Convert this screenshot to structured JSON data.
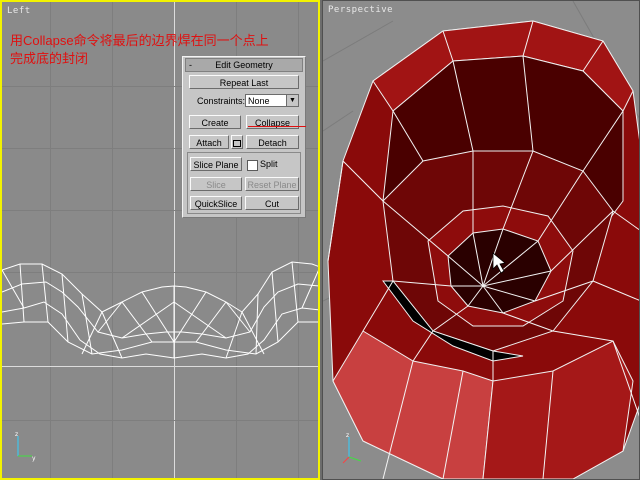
{
  "caption": {
    "line1": "用Collapse命令将最后的边界焊在同一个点上",
    "line2": "完成底的封闭"
  },
  "viewports": {
    "left": {
      "label": "Left"
    },
    "perspective": {
      "label": "Perspective"
    }
  },
  "edit_geometry": {
    "rollout_toggle": "-",
    "title": "Edit Geometry",
    "repeat_last": "Repeat Last",
    "constraints_label": "Constraints:",
    "constraints_value": "None",
    "create": "Create",
    "collapse": "Collapse",
    "attach": "Attach",
    "detach": "Detach",
    "slice_plane": "Slice Plane",
    "split_label": "Split",
    "slice": "Slice",
    "reset_plane": "Reset Plane",
    "quickslice": "QuickSlice",
    "cut": "Cut"
  },
  "colors": {
    "active_viewport_border": "#f2f200",
    "caption_text": "#e01010",
    "mesh_dark": "#3a0000",
    "mesh_mid": "#8a0a0a",
    "mesh_light": "#c84040"
  }
}
